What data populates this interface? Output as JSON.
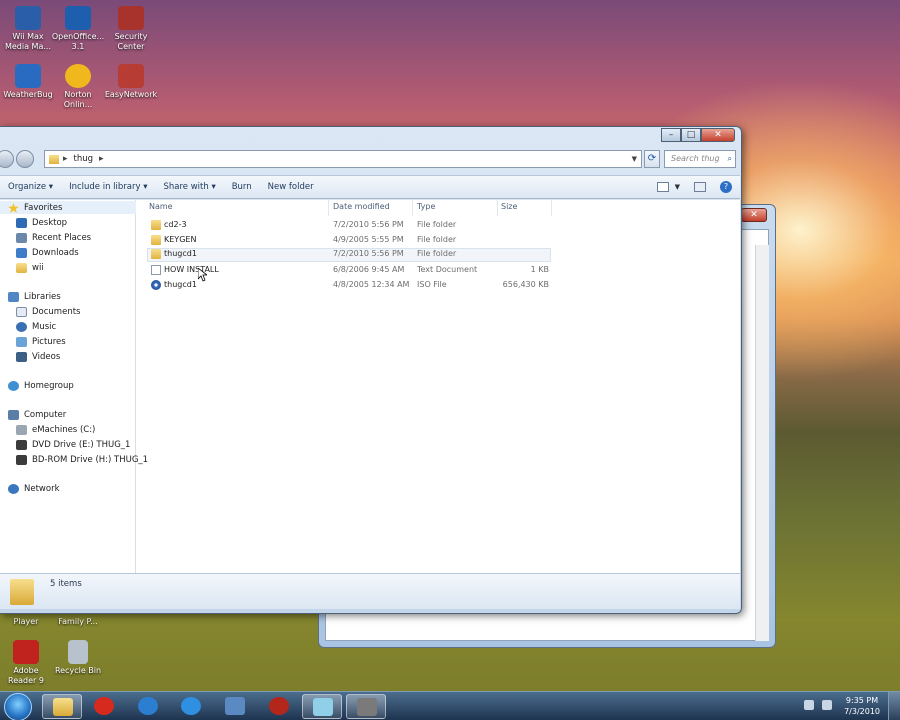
{
  "desktop": {
    "icons": [
      {
        "label": "Wii Max Media Ma...",
        "color": "#2b5ea8"
      },
      {
        "label": "OpenOffice... 3.1",
        "color": "#1d5fae"
      },
      {
        "label": "Security Center",
        "color": "#a8322c"
      },
      {
        "label": "WeatherBug",
        "color": "#2a6bc2"
      },
      {
        "label": "Norton Onlin...",
        "color": "#f0b81c"
      },
      {
        "label": "EasyNetwork",
        "color": "#b73c34"
      },
      {
        "label": "Player",
        "color": "#6b6b6b"
      },
      {
        "label": "Family P...",
        "color": "#6b6b6b"
      },
      {
        "label": "Adobe Reader 9",
        "color": "#c0231e"
      },
      {
        "label": "Recycle Bin",
        "color": "#b8c2cc"
      }
    ]
  },
  "explorer": {
    "breadcrumb": [
      "thug"
    ],
    "search_placeholder": "Search thug",
    "toolbar": {
      "organize": "Organize",
      "include_in_library": "Include in library",
      "share_with": "Share with",
      "burn": "Burn",
      "new_folder": "New folder"
    },
    "nav": {
      "favorites": "Favorites",
      "desktop": "Desktop",
      "recent_places": "Recent Places",
      "downloads": "Downloads",
      "wii": "wii",
      "libraries": "Libraries",
      "documents": "Documents",
      "music": "Music",
      "pictures": "Pictures",
      "videos": "Videos",
      "homegroup": "Homegroup",
      "computer": "Computer",
      "emachines": "eMachines (C:)",
      "dvd_drive": "DVD Drive (E:) THUG_1",
      "bdrom_drive": "BD-ROM Drive (H:) THUG_1",
      "network": "Network"
    },
    "columns": {
      "name": "Name",
      "date_modified": "Date modified",
      "type": "Type",
      "size": "Size"
    },
    "files": [
      {
        "name": "cd2-3",
        "date": "7/2/2010 5:56 PM",
        "type": "File folder",
        "size": "",
        "icon": "folder-icon"
      },
      {
        "name": "KEYGEN",
        "date": "4/9/2005 5:55 PM",
        "type": "File folder",
        "size": "",
        "icon": "folder-icon"
      },
      {
        "name": "thugcd1",
        "date": "7/2/2010 5:56 PM",
        "type": "File folder",
        "size": "",
        "icon": "folder-icon"
      },
      {
        "name": "HOW INSTALL",
        "date": "6/8/2006 9:45 AM",
        "type": "Text Document",
        "size": "1 KB",
        "icon": "text-document-icon"
      },
      {
        "name": "thugcd1",
        "date": "4/8/2005 12:34 AM",
        "type": "ISO File",
        "size": "656,430 KB",
        "icon": "iso-file-icon"
      }
    ],
    "status": "5 items"
  },
  "taskbar": {
    "time": "9:35 PM",
    "date": "7/3/2010",
    "buttons": [
      "explorer-icon",
      "stop-icon",
      "media-player-icon",
      "internet-explorer-icon",
      "app-icon",
      "thps3-icon",
      "notepad-icon",
      "tools-icon"
    ]
  }
}
